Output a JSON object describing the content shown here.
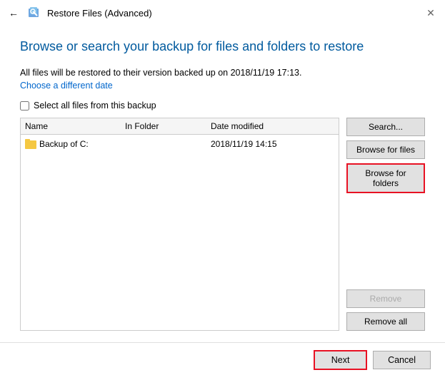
{
  "window": {
    "title": "Restore Files (Advanced)"
  },
  "header": {
    "page_title": "Browse or search your backup for files and folders to restore",
    "info_line": "All files will be restored to their version backed up on 2018/11/19 17:13.",
    "choose_date_link": "Choose a different date",
    "select_all_label": "Select all files from this backup"
  },
  "table": {
    "columns": {
      "name": "Name",
      "in_folder": "In Folder",
      "date_modified": "Date modified"
    },
    "rows": [
      {
        "name": "Backup of C:",
        "in_folder": "",
        "date_modified": "2018/11/19 14:15",
        "type": "folder"
      }
    ]
  },
  "side_buttons": {
    "search": "Search...",
    "browse_files": "Browse for files",
    "browse_folders": "Browse for folders",
    "remove": "Remove",
    "remove_all": "Remove all"
  },
  "footer": {
    "next": "Next",
    "cancel": "Cancel"
  }
}
